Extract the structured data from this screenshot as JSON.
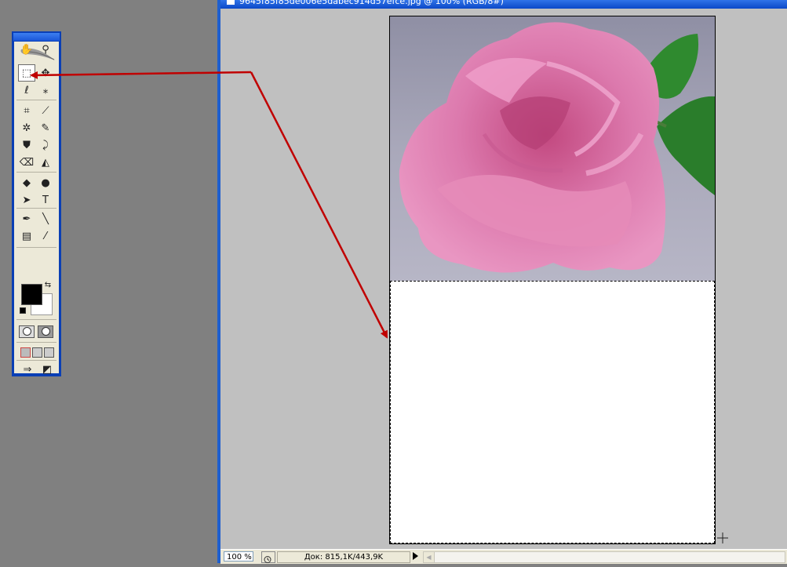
{
  "document": {
    "title": "9645f85f85de006e5dabec914d57efce.jpg @ 100% (RGB/8#)"
  },
  "status_bar": {
    "zoom": "100 %",
    "doc_info": "Док: 815,1K/443,9K"
  },
  "toolbox": {
    "tools": [
      {
        "name": "rectangular-marquee-tool-icon",
        "glyph": "⬚",
        "active": true
      },
      {
        "name": "move-tool-icon",
        "glyph": "✥"
      },
      {
        "name": "lasso-tool-icon",
        "glyph": "ℓ"
      },
      {
        "name": "magic-wand-tool-icon",
        "glyph": "⁎"
      },
      {
        "name": "crop-tool-icon",
        "glyph": "⌗"
      },
      {
        "name": "slice-tool-icon",
        "glyph": "⟋"
      },
      {
        "name": "healing-brush-tool-icon",
        "glyph": "✲"
      },
      {
        "name": "brush-tool-icon",
        "glyph": "✎"
      },
      {
        "name": "clone-stamp-tool-icon",
        "glyph": "⛊"
      },
      {
        "name": "history-brush-tool-icon",
        "glyph": "⤸"
      },
      {
        "name": "eraser-tool-icon",
        "glyph": "⌫"
      },
      {
        "name": "paint-bucket-tool-icon",
        "glyph": "◭"
      },
      {
        "name": "blur-tool-icon",
        "glyph": "◆"
      },
      {
        "name": "dodge-tool-icon",
        "glyph": "●"
      },
      {
        "name": "path-selection-tool-icon",
        "glyph": "➤"
      },
      {
        "name": "type-tool-icon",
        "glyph": "T"
      },
      {
        "name": "pen-tool-icon",
        "glyph": "✒"
      },
      {
        "name": "line-tool-icon",
        "glyph": "╲"
      },
      {
        "name": "notes-tool-icon",
        "glyph": "▤"
      },
      {
        "name": "eyedropper-tool-icon",
        "glyph": "⁄"
      },
      {
        "name": "hand-tool-icon",
        "glyph": "✋"
      },
      {
        "name": "zoom-tool-icon",
        "glyph": "⚲"
      }
    ]
  },
  "colors": {
    "accent": "#0b48c8",
    "arrow": "#c00000",
    "foreground": "#000000",
    "background": "#ffffff"
  }
}
